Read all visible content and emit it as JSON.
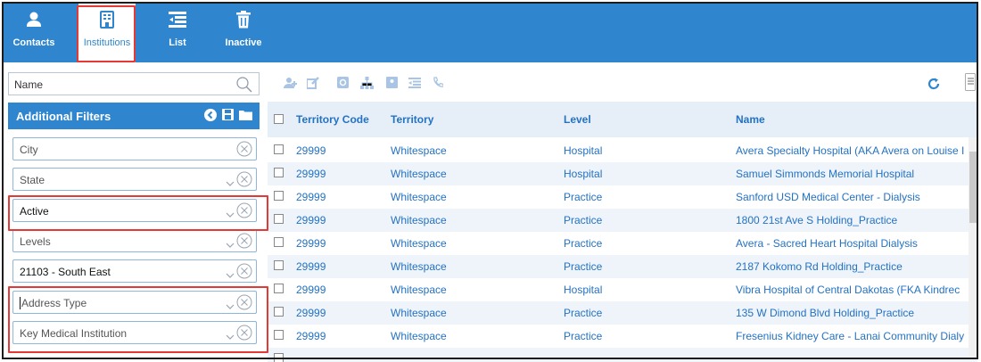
{
  "nav": {
    "contacts": "Contacts",
    "institutions": "Institutions",
    "list": "List",
    "inactive": "Inactive"
  },
  "search": {
    "text": "Name"
  },
  "filters": {
    "header": "Additional Filters",
    "city": "City",
    "state": "State",
    "status": "Active",
    "levels": "Levels",
    "territory": "21103 - South East",
    "address_type": "Address Type",
    "key_medical": "Key Medical Institution"
  },
  "grid": {
    "columns": [
      "Territory Code",
      "Territory",
      "Level",
      "Name"
    ],
    "rows": [
      [
        "29999",
        "Whitespace",
        "Hospital",
        "Avera Specialty Hospital (AKA Avera on Louise I"
      ],
      [
        "29999",
        "Whitespace",
        "Hospital",
        "Samuel Simmonds Memorial Hospital"
      ],
      [
        "29999",
        "Whitespace",
        "Practice",
        "Sanford USD Medical Center - Dialysis"
      ],
      [
        "29999",
        "Whitespace",
        "Practice",
        "1800 21st Ave S Holding_Practice"
      ],
      [
        "29999",
        "Whitespace",
        "Practice",
        "Avera - Sacred Heart Hospital Dialysis"
      ],
      [
        "29999",
        "Whitespace",
        "Practice",
        "2187 Kokomo Rd Holding_Practice"
      ],
      [
        "29999",
        "Whitespace",
        "Hospital",
        "Vibra Hospital of Central Dakotas (FKA Kindrec"
      ],
      [
        "29999",
        "Whitespace",
        "Practice",
        "135 W Dimond Blvd Holding_Practice"
      ],
      [
        "29999",
        "Whitespace",
        "Practice",
        "Fresenius Kidney Care - Lanai Community Dialy"
      ]
    ]
  },
  "colors": {
    "brand": "#2f86cf",
    "link": "#2372c4",
    "highlight": "#e53935"
  }
}
